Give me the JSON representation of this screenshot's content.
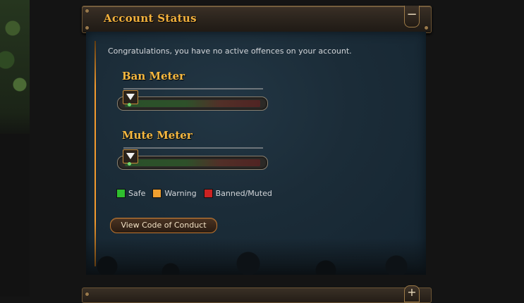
{
  "panel": {
    "title": "Account Status",
    "collapse_symbol": "−",
    "message": "Congratulations, you have no active offences on your account."
  },
  "meters": [
    {
      "label": "Ban Meter",
      "level": 0
    },
    {
      "label": "Mute Meter",
      "level": 0
    }
  ],
  "legend": [
    {
      "label": "Safe",
      "color": "#2fbf2f"
    },
    {
      "label": "Warning",
      "color": "#f0a030"
    },
    {
      "label": "Banned/Muted",
      "color": "#cc2222"
    }
  ],
  "buttons": {
    "code_of_conduct": "View Code of Conduct"
  },
  "next_panel": {
    "expand_symbol": "+"
  },
  "colors": {
    "accent": "#f3b13c",
    "panel_bg": "#1b2c38"
  }
}
